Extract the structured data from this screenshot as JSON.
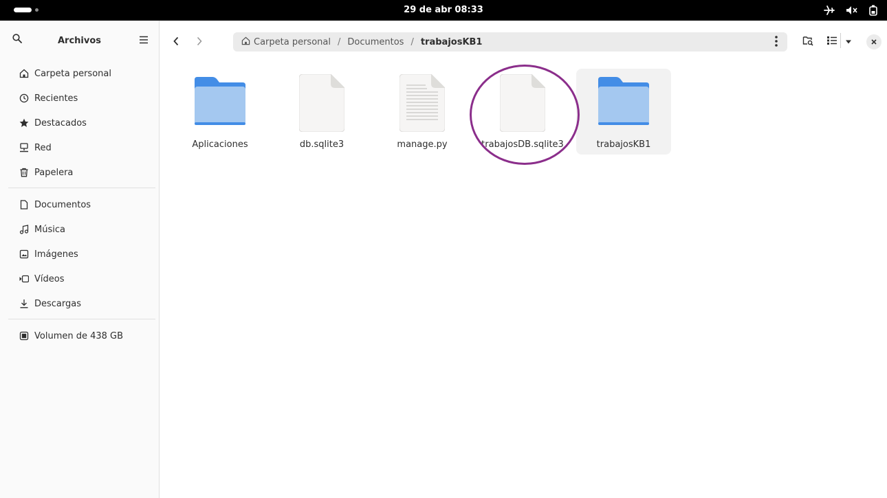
{
  "system": {
    "clock": "29 de abr  08:33"
  },
  "sidebar": {
    "title": "Archivos",
    "places": [
      {
        "label": "Carpeta personal",
        "icon": "home-icon"
      },
      {
        "label": "Recientes",
        "icon": "clock-icon"
      },
      {
        "label": "Destacados",
        "icon": "star-icon"
      },
      {
        "label": "Red",
        "icon": "network-icon"
      },
      {
        "label": "Papelera",
        "icon": "trash-icon"
      }
    ],
    "folders": [
      {
        "label": "Documentos",
        "icon": "document-icon"
      },
      {
        "label": "Música",
        "icon": "music-icon"
      },
      {
        "label": "Imágenes",
        "icon": "image-icon"
      },
      {
        "label": "Vídeos",
        "icon": "video-icon"
      },
      {
        "label": "Descargas",
        "icon": "download-icon"
      }
    ],
    "devices": [
      {
        "label": "Volumen de 438 GB",
        "icon": "drive-icon"
      }
    ]
  },
  "pathbar": {
    "segments": [
      "Carpeta personal",
      "Documentos",
      "trabajosKB1"
    ],
    "separator": "/"
  },
  "files": [
    {
      "name": "Aplicaciones",
      "type": "folder"
    },
    {
      "name": "db.sqlite3",
      "type": "file"
    },
    {
      "name": "manage.py",
      "type": "text"
    },
    {
      "name": "trabajosDB.sqlite3",
      "type": "file"
    },
    {
      "name": "trabajosKB1",
      "type": "folder"
    }
  ],
  "colors": {
    "annotation": "#8b2e8b",
    "folder_back": "#438de6",
    "folder_front": "#a4c8f0"
  }
}
